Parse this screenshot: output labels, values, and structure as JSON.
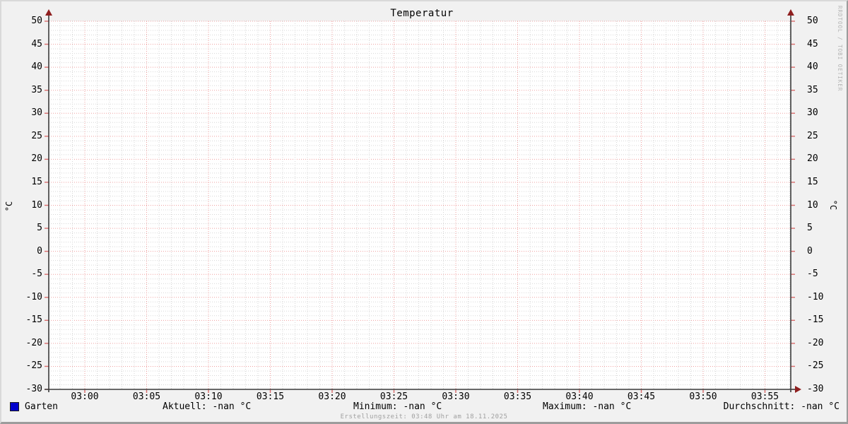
{
  "title": "Temperatur",
  "watermark": "RRDTOOL / TOBI OETIKER",
  "footer": "Erstellungszeit: 03:48 Uhr am 18.11.2025",
  "legend": {
    "series": [
      {
        "label": "Garten",
        "color": "#0000cc",
        "swatch_icon": "blue-square"
      }
    ],
    "stats": {
      "aktuell": "Aktuell: -nan °C",
      "minimum": "Minimum: -nan °C",
      "maximum": "Maximum: -nan °C",
      "durchschnitt": "Durchschnitt: -nan °C"
    }
  },
  "chart_data": {
    "type": "line",
    "title": "Temperatur",
    "ylabel": "°C",
    "ylabel_right": "°C",
    "xlabel": "",
    "ylim": [
      -30,
      50
    ],
    "y_major_step": 5,
    "y_minor_step": 1,
    "y_ticks": [
      -30,
      -25,
      -20,
      -15,
      -10,
      -5,
      0,
      5,
      10,
      15,
      20,
      25,
      30,
      35,
      40,
      45,
      50
    ],
    "x_ticks": [
      "03:00",
      "03:05",
      "03:10",
      "03:15",
      "03:20",
      "03:25",
      "03:30",
      "03:35",
      "03:40",
      "03:45",
      "03:50",
      "03:55"
    ],
    "x_minor_step_minutes": 1,
    "x_major_step_minutes": 5,
    "grid": true,
    "legend_position": "bottom",
    "series": [
      {
        "name": "Garten",
        "color": "#0000cc",
        "values": []
      }
    ],
    "data_status": "-nan (no values plotted)"
  },
  "colors": {
    "background": "#f1f1f1",
    "plot_background": "#ffffff",
    "major_grid": "#ef9f9f",
    "minor_grid": "#d7d7d7",
    "axis": "#3a3a3a",
    "tick": "#d96b6b",
    "arrow": "#8f1f1f",
    "series_garten": "#0000cc",
    "muted_text": "#a0a0a0",
    "watermark_text": "#b4b4b4"
  }
}
